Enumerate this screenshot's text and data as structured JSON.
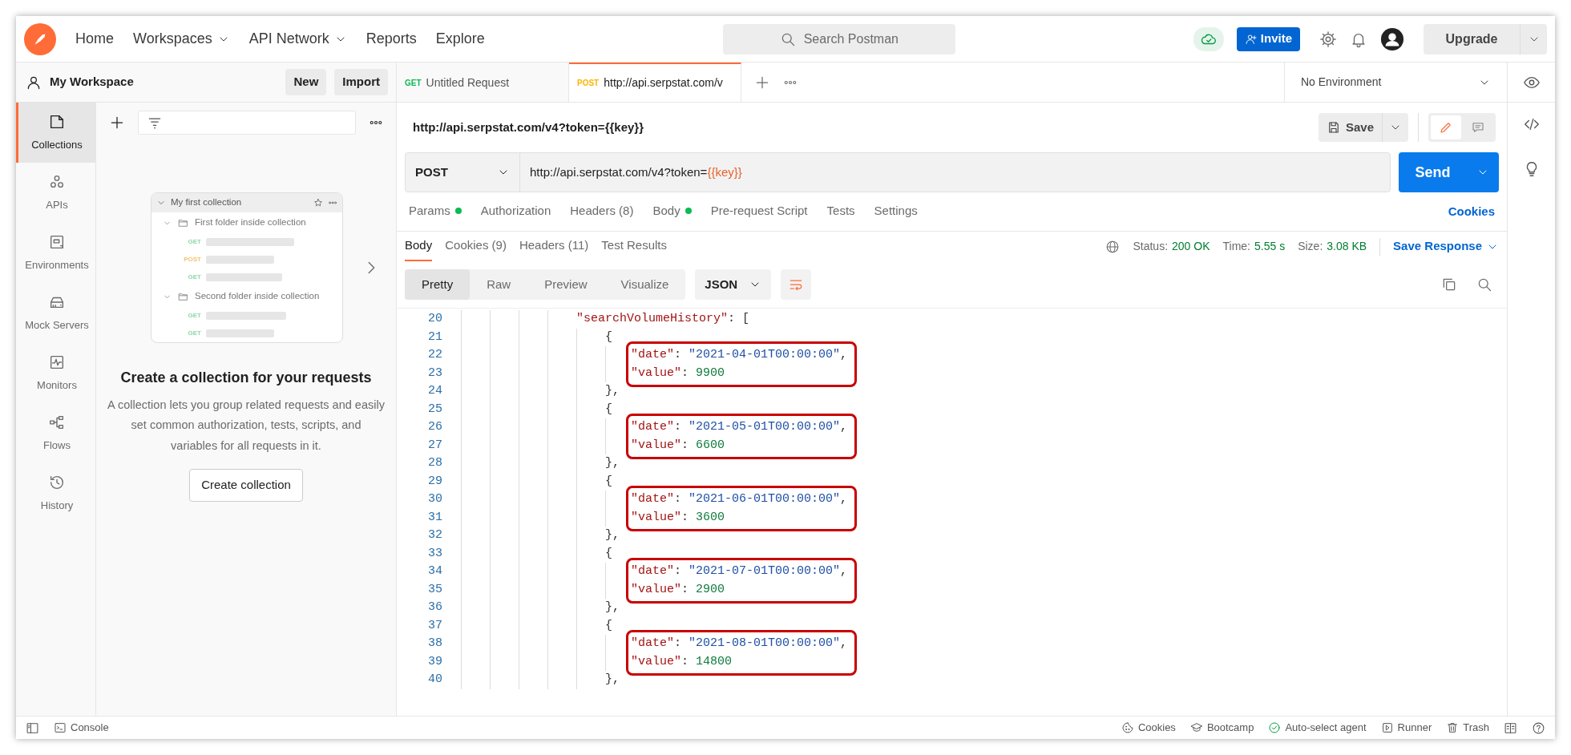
{
  "topbar": {
    "nav": [
      {
        "label": "Home",
        "dropdown": false
      },
      {
        "label": "Workspaces",
        "dropdown": true
      },
      {
        "label": "API Network",
        "dropdown": true
      },
      {
        "label": "Reports",
        "dropdown": false
      },
      {
        "label": "Explore",
        "dropdown": false
      }
    ],
    "search": {
      "placeholder": "Search Postman"
    },
    "invite": "Invite",
    "upgrade": "Upgrade"
  },
  "workspace": {
    "title": "My Workspace",
    "buttons": [
      "New",
      "Import"
    ]
  },
  "request_tabs": [
    {
      "method": "GET",
      "color": "#0cbb52",
      "label": "Untitled Request",
      "selected": false
    },
    {
      "method": "POST",
      "color": "#ffb400",
      "label": "http://api.serpstat.com/v",
      "selected": true
    }
  ],
  "environment": "No Environment",
  "sidebar": {
    "items": [
      {
        "label": "Collections",
        "selected": true
      },
      {
        "label": "APIs",
        "selected": false
      },
      {
        "label": "Environments",
        "selected": false
      },
      {
        "label": "Mock Servers",
        "selected": false
      },
      {
        "label": "Monitors",
        "selected": false
      },
      {
        "label": "Flows",
        "selected": false
      },
      {
        "label": "History",
        "selected": false
      }
    ]
  },
  "collections_panel": {
    "preview": {
      "title": "My first collection",
      "folders": [
        {
          "name": "First folder inside collection",
          "requests": [
            {
              "method": "GET",
              "color": "#8fd6a8"
            },
            {
              "method": "POST",
              "color": "#f5c36b"
            },
            {
              "method": "GET",
              "color": "#8fd6a8"
            }
          ]
        },
        {
          "name": "Second folder inside collection",
          "requests": [
            {
              "method": "GET",
              "color": "#8fd6a8"
            },
            {
              "method": "GET",
              "color": "#8fd6a8"
            }
          ]
        }
      ]
    },
    "heading": "Create a collection for your requests",
    "description": "A collection lets you group related requests and easily set common authorization, tests, scripts, and variables for all requests in it.",
    "button": "Create collection"
  },
  "request": {
    "title": "http://api.serpstat.com/v4?token={{key}}",
    "save": "Save",
    "mode_toggle": [
      {
        "kind": "edit",
        "selected": true
      },
      {
        "kind": "comments",
        "selected": false
      }
    ],
    "method": "POST",
    "url": "http://api.serpstat.com/v4?token=",
    "url_variable": "{{key}}",
    "send": "Send",
    "tabs": [
      {
        "label": "Params",
        "dot": true,
        "selected": false
      },
      {
        "label": "Authorization",
        "dot": false,
        "selected": false
      },
      {
        "label": "Headers (8)",
        "dot": false,
        "selected": false
      },
      {
        "label": "Body",
        "dot": true,
        "selected": false
      },
      {
        "label": "Pre-request Script",
        "dot": false,
        "selected": false
      },
      {
        "label": "Tests",
        "dot": false,
        "selected": false
      },
      {
        "label": "Settings",
        "dot": false,
        "selected": false
      }
    ],
    "cookies": "Cookies"
  },
  "response": {
    "tabs": [
      {
        "label": "Body",
        "selected": true
      },
      {
        "label": "Cookies (9)",
        "selected": false
      },
      {
        "label": "Headers (11)",
        "selected": false
      },
      {
        "label": "Test Results",
        "selected": false
      }
    ],
    "status": [
      {
        "label": "Status:",
        "value": "200 OK"
      },
      {
        "label": "Time:",
        "value": "5.55 s"
      },
      {
        "label": "Size:",
        "value": "3.08 KB"
      }
    ],
    "save_response": "Save Response",
    "views": [
      {
        "label": "Pretty",
        "selected": true
      },
      {
        "label": "Raw",
        "selected": false
      },
      {
        "label": "Preview",
        "selected": false
      },
      {
        "label": "Visualize",
        "selected": false
      }
    ],
    "format": "JSON",
    "lines": [
      {
        "number": "20",
        "kind": "array-open",
        "highlighted": false,
        "tokens": [
          {
            "kind": "key",
            "text": "\"searchVolumeHistory\""
          },
          {
            "kind": "punct",
            "text": ": ["
          }
        ]
      },
      {
        "number": "21",
        "kind": "object-open",
        "highlighted": false,
        "tokens": [
          {
            "kind": "punct",
            "text": "{"
          }
        ]
      },
      {
        "number": "22",
        "kind": "field",
        "highlighted": true,
        "tokens": [
          {
            "kind": "key",
            "text": "\"date\""
          },
          {
            "kind": "punct",
            "text": ": "
          },
          {
            "kind": "string",
            "text": "\"2021-04-01T00:00:00\""
          },
          {
            "kind": "punct",
            "text": ","
          }
        ]
      },
      {
        "number": "23",
        "kind": "field",
        "highlighted": true,
        "tokens": [
          {
            "kind": "key",
            "text": "\"value\""
          },
          {
            "kind": "punct",
            "text": ": "
          },
          {
            "kind": "number",
            "text": "9900"
          }
        ]
      },
      {
        "number": "24",
        "kind": "object-close",
        "highlighted": false,
        "tokens": [
          {
            "kind": "punct",
            "text": "},"
          }
        ]
      },
      {
        "number": "25",
        "kind": "object-open",
        "highlighted": false,
        "tokens": [
          {
            "kind": "punct",
            "text": "{"
          }
        ]
      },
      {
        "number": "26",
        "kind": "field",
        "highlighted": true,
        "tokens": [
          {
            "kind": "key",
            "text": "\"date\""
          },
          {
            "kind": "punct",
            "text": ": "
          },
          {
            "kind": "string",
            "text": "\"2021-05-01T00:00:00\""
          },
          {
            "kind": "punct",
            "text": ","
          }
        ]
      },
      {
        "number": "27",
        "kind": "field",
        "highlighted": true,
        "tokens": [
          {
            "kind": "key",
            "text": "\"value\""
          },
          {
            "kind": "punct",
            "text": ": "
          },
          {
            "kind": "number",
            "text": "6600"
          }
        ]
      },
      {
        "number": "28",
        "kind": "object-close",
        "highlighted": false,
        "tokens": [
          {
            "kind": "punct",
            "text": "},"
          }
        ]
      },
      {
        "number": "29",
        "kind": "object-open",
        "highlighted": false,
        "tokens": [
          {
            "kind": "punct",
            "text": "{"
          }
        ]
      },
      {
        "number": "30",
        "kind": "field",
        "highlighted": true,
        "tokens": [
          {
            "kind": "key",
            "text": "\"date\""
          },
          {
            "kind": "punct",
            "text": ": "
          },
          {
            "kind": "string",
            "text": "\"2021-06-01T00:00:00\""
          },
          {
            "kind": "punct",
            "text": ","
          }
        ]
      },
      {
        "number": "31",
        "kind": "field",
        "highlighted": true,
        "tokens": [
          {
            "kind": "key",
            "text": "\"value\""
          },
          {
            "kind": "punct",
            "text": ": "
          },
          {
            "kind": "number",
            "text": "3600"
          }
        ]
      },
      {
        "number": "32",
        "kind": "object-close",
        "highlighted": false,
        "tokens": [
          {
            "kind": "punct",
            "text": "},"
          }
        ]
      },
      {
        "number": "33",
        "kind": "object-open",
        "highlighted": false,
        "tokens": [
          {
            "kind": "punct",
            "text": "{"
          }
        ]
      },
      {
        "number": "34",
        "kind": "field",
        "highlighted": true,
        "tokens": [
          {
            "kind": "key",
            "text": "\"date\""
          },
          {
            "kind": "punct",
            "text": ": "
          },
          {
            "kind": "string",
            "text": "\"2021-07-01T00:00:00\""
          },
          {
            "kind": "punct",
            "text": ","
          }
        ]
      },
      {
        "number": "35",
        "kind": "field",
        "highlighted": true,
        "tokens": [
          {
            "kind": "key",
            "text": "\"value\""
          },
          {
            "kind": "punct",
            "text": ": "
          },
          {
            "kind": "number",
            "text": "2900"
          }
        ]
      },
      {
        "number": "36",
        "kind": "object-close",
        "highlighted": false,
        "tokens": [
          {
            "kind": "punct",
            "text": "},"
          }
        ]
      },
      {
        "number": "37",
        "kind": "object-open",
        "highlighted": false,
        "tokens": [
          {
            "kind": "punct",
            "text": "{"
          }
        ]
      },
      {
        "number": "38",
        "kind": "field",
        "highlighted": true,
        "tokens": [
          {
            "kind": "key",
            "text": "\"date\""
          },
          {
            "kind": "punct",
            "text": ": "
          },
          {
            "kind": "string",
            "text": "\"2021-08-01T00:00:00\""
          },
          {
            "kind": "punct",
            "text": ","
          }
        ]
      },
      {
        "number": "39",
        "kind": "field",
        "highlighted": true,
        "tokens": [
          {
            "kind": "key",
            "text": "\"value\""
          },
          {
            "kind": "punct",
            "text": ": "
          },
          {
            "kind": "number",
            "text": "14800"
          }
        ]
      },
      {
        "number": "40",
        "kind": "object-close",
        "highlighted": false,
        "tokens": [
          {
            "kind": "punct",
            "text": "},"
          }
        ]
      }
    ]
  },
  "status_bar": {
    "left": [
      "Console"
    ],
    "right": [
      "Cookies",
      "Bootcamp",
      "Auto-select agent",
      "Runner",
      "Trash"
    ]
  }
}
